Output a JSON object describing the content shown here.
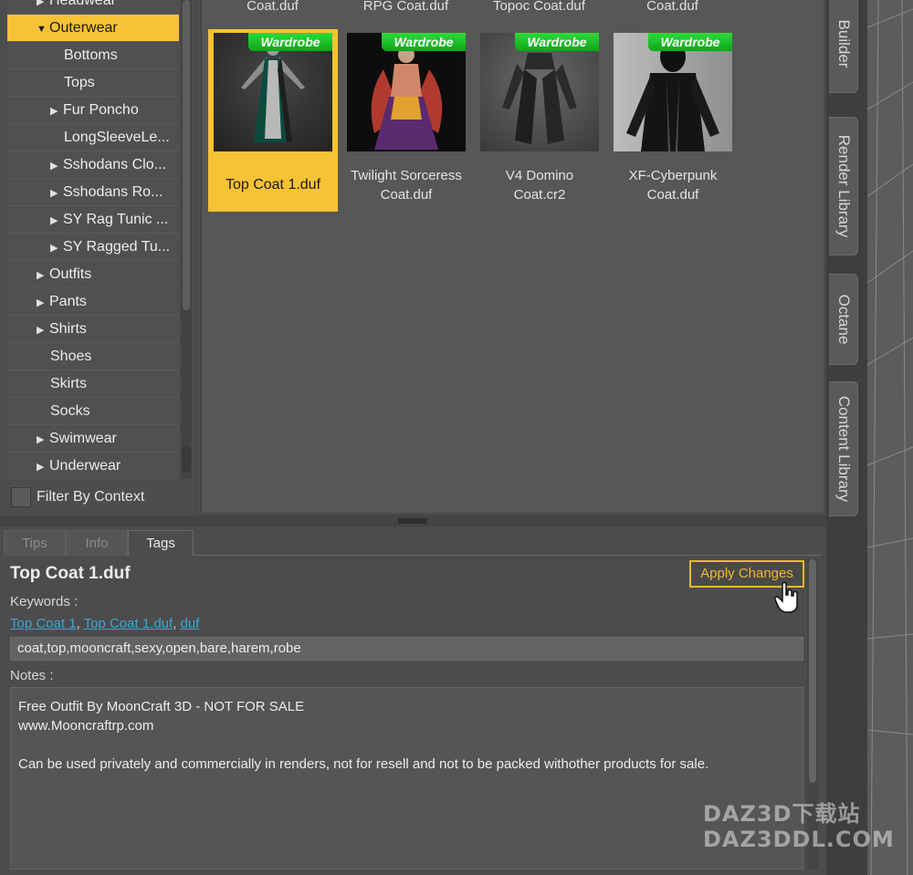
{
  "tree": {
    "items": [
      {
        "label": "Headwear",
        "arrow": "▶",
        "indent": 1
      },
      {
        "label": "Outerwear",
        "arrow": "▼",
        "indent": 1,
        "selected": true
      },
      {
        "label": "Bottoms",
        "arrow": "",
        "indent": 2
      },
      {
        "label": "Tops",
        "arrow": "",
        "indent": 2
      },
      {
        "label": "Fur Poncho",
        "arrow": "▶",
        "indent": 2
      },
      {
        "label": "LongSleeveLe...",
        "arrow": "",
        "indent": 2
      },
      {
        "label": "Sshodans Clo...",
        "arrow": "▶",
        "indent": 2
      },
      {
        "label": "Sshodans Ro...",
        "arrow": "▶",
        "indent": 2
      },
      {
        "label": "SY Rag Tunic ...",
        "arrow": "▶",
        "indent": 2
      },
      {
        "label": "SY Ragged Tu...",
        "arrow": "▶",
        "indent": 2
      },
      {
        "label": "Outfits",
        "arrow": "▶",
        "indent": 1
      },
      {
        "label": "Pants",
        "arrow": "▶",
        "indent": 1
      },
      {
        "label": "Shirts",
        "arrow": "▶",
        "indent": 1
      },
      {
        "label": "Shoes",
        "arrow": "",
        "indent": 1
      },
      {
        "label": "Skirts",
        "arrow": "",
        "indent": 1
      },
      {
        "label": "Socks",
        "arrow": "",
        "indent": 1
      },
      {
        "label": "Swimwear",
        "arrow": "▶",
        "indent": 1
      },
      {
        "label": "Underwear",
        "arrow": "▶",
        "indent": 1
      }
    ],
    "filter_label": "Filter By Context"
  },
  "content": {
    "top_labels": [
      "Coat.duf",
      "RPG Coat.duf",
      "Topoc Coat.duf",
      "Coat.duf"
    ],
    "badge_text": "Wardrobe",
    "tiles": [
      {
        "line1": "Top Coat 1.duf",
        "line2": "",
        "selected": true,
        "thumb": "green-coat-figure"
      },
      {
        "line1": "Twilight Sorceress",
        "line2": "Coat.duf",
        "selected": false,
        "thumb": "sorceress-figure"
      },
      {
        "line1": "V4 Domino",
        "line2": "Coat.cr2",
        "selected": false,
        "thumb": "domino-coat"
      },
      {
        "line1": "XF-Cyberpunk",
        "line2": "Coat.duf",
        "selected": false,
        "thumb": "cyberpunk-figure"
      }
    ]
  },
  "bottom": {
    "tabs": [
      "Tips",
      "Info",
      "Tags"
    ],
    "active_tab": "Tags",
    "title": "Top Coat 1.duf",
    "apply_label": "Apply Changes",
    "keywords_label": "Keywords :",
    "keyword_links": [
      "Top Coat 1",
      "Top Coat 1.duf",
      "duf"
    ],
    "keyword_value": "coat,top,mooncraft,sexy,open,bare,harem,robe",
    "notes_label": "Notes :",
    "notes_lines": [
      "Free Outfit By MoonCraft 3D - NOT FOR SALE",
      "www.Mooncraftrp.com",
      "",
      "Can be used privately and commercially in renders, not for resell and not to be packed withother products for sale."
    ]
  },
  "side_tabs": [
    "Builder",
    "Render Library",
    "Octane",
    "Content Library"
  ],
  "watermark": {
    "line1": "DAZ3D下载站",
    "line2": "DAZ3DDL.COM"
  },
  "colors": {
    "accent": "#f7c235",
    "badge_green": "#17b823",
    "link": "#3ea3d8"
  }
}
